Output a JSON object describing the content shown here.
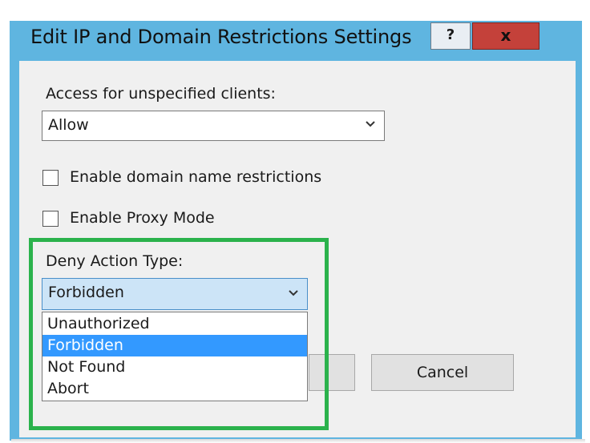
{
  "dialog": {
    "title": "Edit IP and Domain Restrictions Settings",
    "help_label": "?",
    "close_label": "x"
  },
  "access": {
    "label": "Access for unspecified clients:",
    "value": "Allow"
  },
  "checkboxes": {
    "domain_restrictions": {
      "label": "Enable domain name restrictions",
      "checked": false
    },
    "proxy_mode": {
      "label": "Enable Proxy Mode",
      "checked": false
    }
  },
  "deny_action": {
    "label": "Deny Action Type:",
    "value": "Forbidden",
    "options": [
      "Unauthorized",
      "Forbidden",
      "Not Found",
      "Abort"
    ],
    "highlighted_option": "Forbidden"
  },
  "buttons": {
    "ok_label": "",
    "cancel_label": "Cancel"
  },
  "colors": {
    "window_border": "#5fb5e0",
    "close_button": "#c4413a",
    "selection": "#3399ff",
    "annotation_box": "#2bb24c",
    "combo_focus": "#cce4f7"
  }
}
